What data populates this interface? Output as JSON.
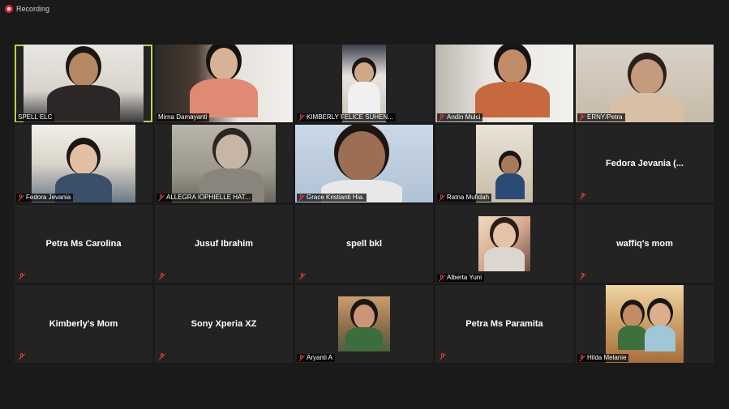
{
  "recording": {
    "label": "Recording"
  },
  "participants": [
    {
      "name": "SPELL ELC",
      "type": "video",
      "active": true,
      "muted": false
    },
    {
      "name": "Mirna Damayanti",
      "type": "video",
      "muted": false
    },
    {
      "name": "KIMBERLY FELICE SUHEN...",
      "type": "video",
      "muted": true
    },
    {
      "name": "Andin Mulci",
      "type": "video",
      "muted": true
    },
    {
      "name": "ERNY/Petra",
      "type": "video",
      "muted": true
    },
    {
      "name": "Fedora Jevania",
      "type": "video",
      "muted": true
    },
    {
      "name": "ALLEGRA IOPHIELLE HAT...",
      "type": "video",
      "muted": true
    },
    {
      "name": "Grace Kristianti Hia.",
      "type": "video",
      "muted": true
    },
    {
      "name": "Ratna Mufidah",
      "type": "video",
      "muted": true
    },
    {
      "name": "Fedora Jevania (...",
      "type": "name",
      "muted": true
    },
    {
      "name": "Petra Ms Carolina",
      "type": "name",
      "muted": true
    },
    {
      "name": "Jusuf Ibrahim",
      "type": "name",
      "muted": true
    },
    {
      "name": "spell bkl",
      "type": "name",
      "muted": true
    },
    {
      "name": "Alberta Yuni",
      "type": "picture",
      "muted": true
    },
    {
      "name": "waffiq's mom",
      "type": "name",
      "muted": true
    },
    {
      "name": "Kimberly's Mom",
      "type": "name",
      "muted": true
    },
    {
      "name": "Sony Xperia XZ",
      "type": "name",
      "muted": true
    },
    {
      "name": "Aryanti A",
      "type": "picture",
      "muted": true
    },
    {
      "name": "Petra Ms Paramita",
      "type": "name",
      "muted": true
    },
    {
      "name": "Hilda Melanie",
      "type": "picture",
      "muted": true
    }
  ],
  "icons": {
    "recording": "record-dot-icon",
    "muted": "mic-muted-icon"
  },
  "colors": {
    "active_speaker": "#b9d64a",
    "tile_bg": "#232323",
    "muted": "#e04040"
  }
}
